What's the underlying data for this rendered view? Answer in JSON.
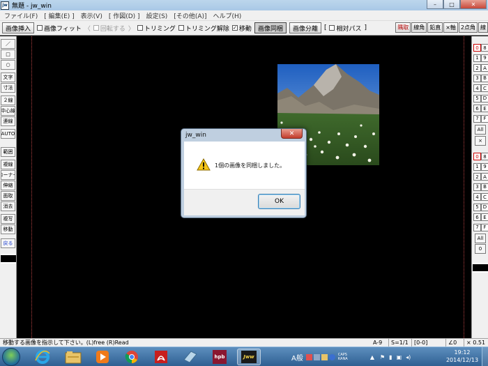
{
  "window": {
    "title": "無題 - jw_win",
    "app_icon_text": "jw",
    "minimize": "–",
    "maximize": "□",
    "close": "✕"
  },
  "menu": [
    "ファイル(F)",
    "[ 編集(E) ]",
    "表示(V)",
    "[ 作図(D) ]",
    "設定(S)",
    "[その他(A)]",
    "ヘルプ(H)"
  ],
  "toolbar": {
    "insert_image": "画像挿入",
    "fit_image": "画像フィット",
    "rotate_open": "〈",
    "rotate": "回転する",
    "rotate_close": "〉",
    "trimming": "トリミング",
    "trimming_cancel": "トリミング解除",
    "move": "移動",
    "move_checked": "✓",
    "image_bundle": "画像同梱",
    "image_split": "画像分離",
    "bracket_open": "[",
    "relative_path": "相対パス",
    "bracket_close": "]",
    "right": [
      "隅取",
      "線角",
      "鉛直",
      "×軸",
      "2点角",
      "線"
    ]
  },
  "left_tools": [
    "／",
    "□",
    "○",
    "文字",
    "寸法",
    "２線",
    "中心線",
    "連線",
    "AUTO",
    "範囲",
    "複線",
    "コーナー",
    "伸縮",
    "面取",
    "消去",
    "複写",
    "移動",
    "戻る"
  ],
  "right_layers": {
    "group1": [
      "0",
      "8",
      "1",
      "9",
      "2",
      "A",
      "3",
      "B",
      "4",
      "C",
      "5",
      "D",
      "6",
      "E",
      "7",
      "F"
    ],
    "group1_all": "All",
    "group1_x": "×",
    "group2": [
      "0",
      "8",
      "1",
      "9",
      "2",
      "A",
      "3",
      "B",
      "4",
      "C",
      "5",
      "D",
      "6",
      "E",
      "7",
      "F"
    ],
    "group2_all": "All",
    "group2_zero": "0"
  },
  "dialog": {
    "title": "jw_win",
    "close": "✕",
    "message": "1個の画像を同梱しました。",
    "ok": "OK",
    "icon": "warning-icon"
  },
  "status": {
    "message": "移動する画像を指示して下さい。(L)free (R)Read",
    "layer": "A-9",
    "scale": "S=1/1",
    "group": "[0-0]",
    "angle": "∠0",
    "zoom": "× 0.51"
  },
  "taskbar": {
    "ime": "A般",
    "ime_label": "CAPS KANA",
    "time": "19:12",
    "date": "2014/12/13",
    "apps": [
      "internet-explorer-icon",
      "explorer-icon",
      "media-player-icon",
      "chrome-icon",
      "acrobat-icon",
      "notebook-icon",
      "hpb-icon",
      "jww-icon"
    ],
    "hpb_label": "hpb",
    "jww_label": "Jww"
  }
}
